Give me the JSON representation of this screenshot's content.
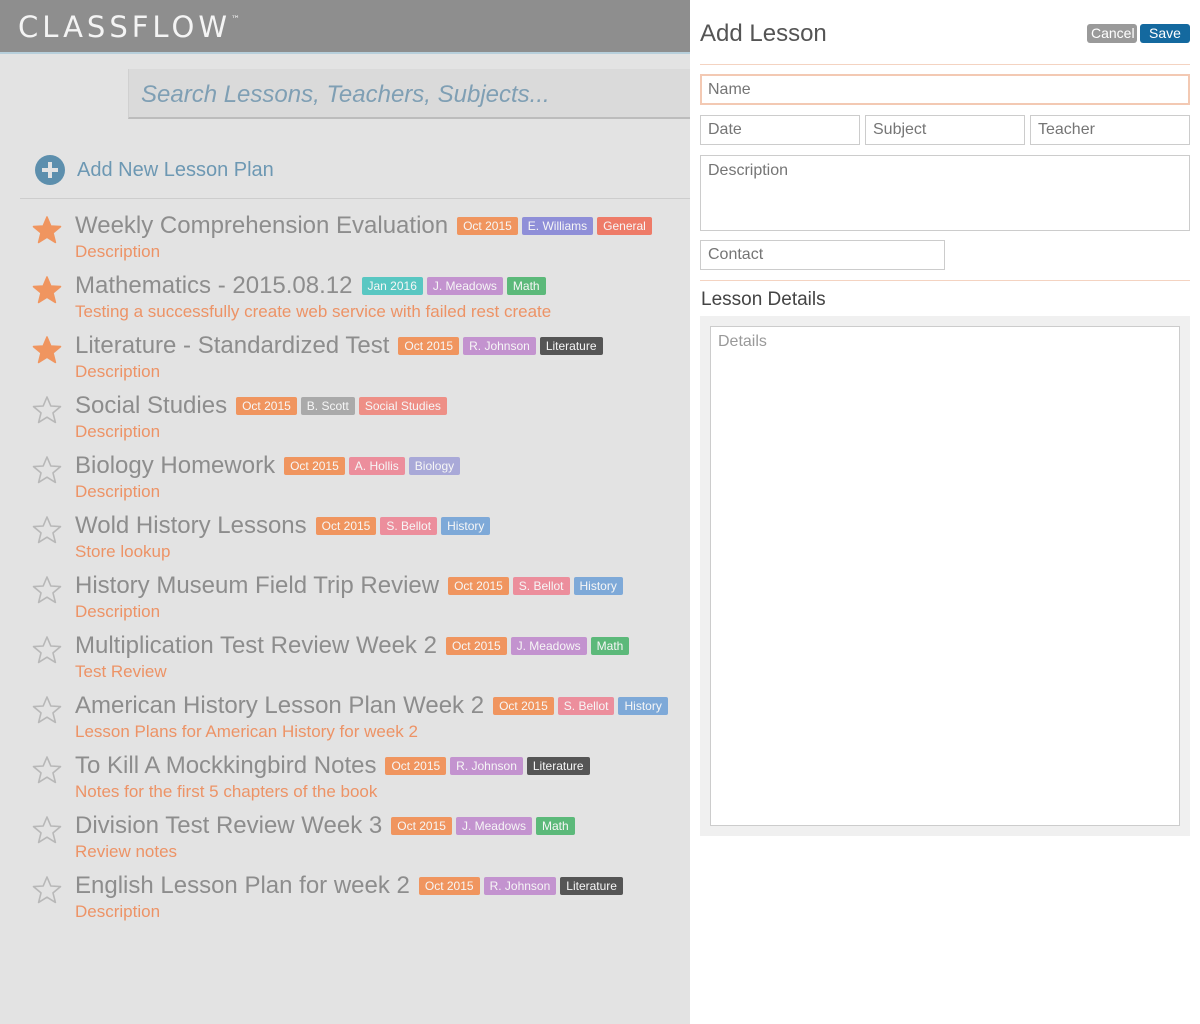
{
  "app": {
    "logo": "CLASSFLOW",
    "tm": "™"
  },
  "search": {
    "placeholder": "Search Lessons, Teachers, Subjects..."
  },
  "add_plan": {
    "label": "Add New Lesson Plan"
  },
  "colors": {
    "accent_orange": "#ed9366",
    "link_blue": "#6d98b3",
    "star_filled": "#f0955f",
    "star_empty": "#b8b8b8",
    "save_button": "#14699f",
    "cancel_button": "#9a9a9a"
  },
  "lessons": [
    {
      "title": "Weekly Comprehension Evaluation",
      "starred": true,
      "date": "Oct 2015",
      "date_color": "#f0955f",
      "teacher": "E. Williams",
      "teacher_color": "#8f8fd8",
      "subject": "General",
      "subject_color": "#ee7b68",
      "description": "Description"
    },
    {
      "title": "Mathematics - 2015.08.12",
      "starred": true,
      "date": "Jan 2016",
      "date_color": "#59c7c2",
      "teacher": "J. Meadows",
      "teacher_color": "#c393cf",
      "subject": "Math",
      "subject_color": "#5cb97a",
      "description": "Testing a successfully create web service with failed rest create"
    },
    {
      "title": "Literature - Standardized Test",
      "starred": true,
      "date": "Oct 2015",
      "date_color": "#f0955f",
      "teacher": "R. Johnson",
      "teacher_color": "#c393cf",
      "subject": "Literature",
      "subject_color": "#555555",
      "description": "Description"
    },
    {
      "title": "Social Studies",
      "starred": false,
      "date": "Oct 2015",
      "date_color": "#f0955f",
      "teacher": "B. Scott",
      "teacher_color": "#aaaaaa",
      "subject": "Social Studies",
      "subject_color": "#ee8f86",
      "description": "Description"
    },
    {
      "title": "Biology Homework",
      "starred": false,
      "date": "Oct 2015",
      "date_color": "#f0955f",
      "teacher": "A. Hollis",
      "teacher_color": "#ec8e9c",
      "subject": "Biology",
      "subject_color": "#a9a9d8",
      "description": "Description"
    },
    {
      "title": "Wold History Lessons",
      "starred": false,
      "date": "Oct 2015",
      "date_color": "#f0955f",
      "teacher": "S. Bellot",
      "teacher_color": "#ec8e9c",
      "subject": "History",
      "subject_color": "#7ea9d8",
      "description": "Store lookup"
    },
    {
      "title": "History Museum Field Trip Review",
      "starred": false,
      "date": "Oct 2015",
      "date_color": "#f0955f",
      "teacher": "S. Bellot",
      "teacher_color": "#ec8e9c",
      "subject": "History",
      "subject_color": "#7ea9d8",
      "description": "Description"
    },
    {
      "title": "Multiplication Test Review Week 2",
      "starred": false,
      "date": "Oct 2015",
      "date_color": "#f0955f",
      "teacher": "J. Meadows",
      "teacher_color": "#c393cf",
      "subject": "Math",
      "subject_color": "#5cb97a",
      "description": "Test Review"
    },
    {
      "title": "American History Lesson Plan Week 2",
      "starred": false,
      "date": "Oct 2015",
      "date_color": "#f0955f",
      "teacher": "S. Bellot",
      "teacher_color": "#ec8e9c",
      "subject": "History",
      "subject_color": "#7ea9d8",
      "description": "Lesson Plans for American History for week 2"
    },
    {
      "title": "To Kill A Mockkingbird Notes",
      "starred": false,
      "date": "Oct 2015",
      "date_color": "#f0955f",
      "teacher": "R. Johnson",
      "teacher_color": "#c393cf",
      "subject": "Literature",
      "subject_color": "#555555",
      "description": "Notes for the first 5 chapters of the book"
    },
    {
      "title": "Division Test Review Week 3",
      "starred": false,
      "date": "Oct 2015",
      "date_color": "#f0955f",
      "teacher": "J. Meadows",
      "teacher_color": "#c393cf",
      "subject": "Math",
      "subject_color": "#5cb97a",
      "description": "Review notes"
    },
    {
      "title": "English Lesson Plan for week 2",
      "starred": false,
      "date": "Oct 2015",
      "date_color": "#f0955f",
      "teacher": "R. Johnson",
      "teacher_color": "#c393cf",
      "subject": "Literature",
      "subject_color": "#555555",
      "description": "Description"
    }
  ],
  "panel": {
    "title": "Add Lesson",
    "cancel_label": "Cancel",
    "save_label": "Save",
    "name_placeholder": "Name",
    "date_placeholder": "Date",
    "subject_placeholder": "Subject",
    "teacher_placeholder": "Teacher",
    "description_placeholder": "Description",
    "contact_placeholder": "Contact",
    "details_title": "Lesson Details",
    "details_placeholder": "Details"
  }
}
